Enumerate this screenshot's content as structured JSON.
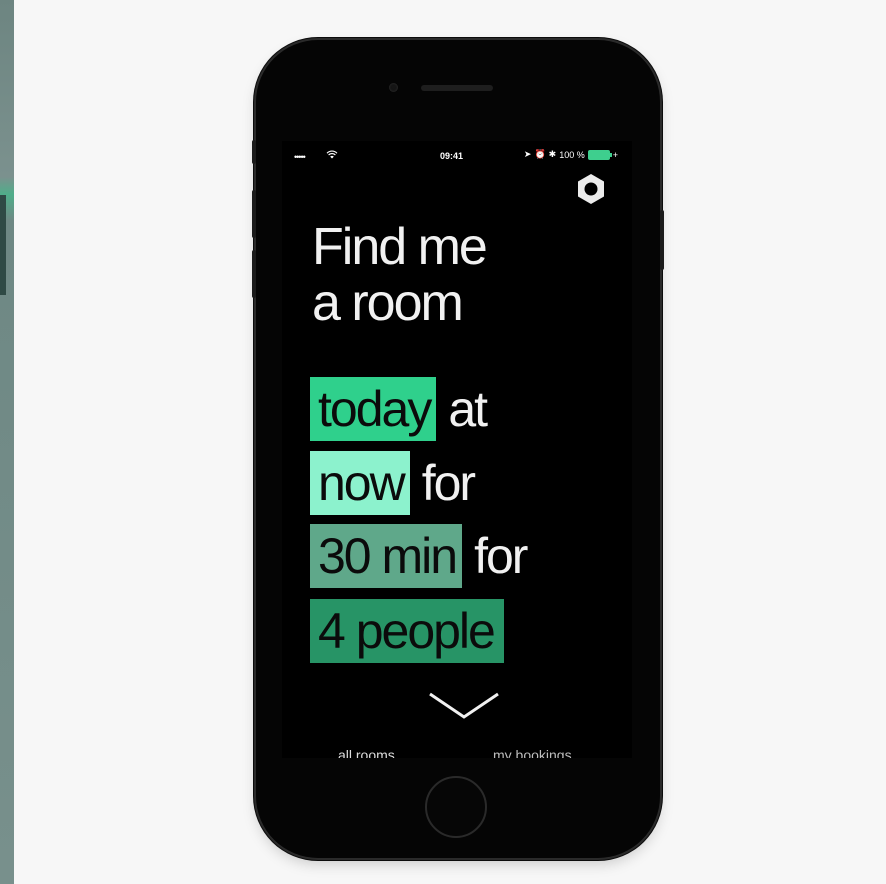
{
  "status_bar": {
    "signal": "•••••",
    "time": "09:41",
    "battery_percent": "100 %",
    "battery_color": "#3ecf8e"
  },
  "icons": {
    "settings": "hexagon-settings-icon",
    "wifi": "wifi-icon",
    "chevron": "chevron-down-icon"
  },
  "headline": {
    "line1": "Find me",
    "line2": "a room"
  },
  "query": {
    "date_value": "today",
    "date_suffix": "at",
    "time_value": "now",
    "time_suffix": "for",
    "duration_value": "30 min",
    "duration_suffix": "for",
    "people_value": "4 people"
  },
  "chip_colors": {
    "date": "#2fd08c",
    "time": "#8cf2cd",
    "duration": "#5fa88a",
    "people": "#279466"
  },
  "tabs": {
    "all_rooms": "all rooms",
    "my_bookings": "my bookings",
    "active": "all rooms"
  }
}
